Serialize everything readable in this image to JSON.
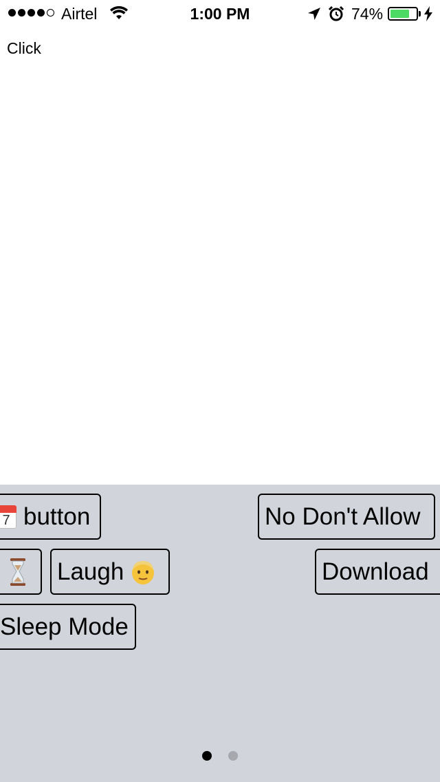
{
  "status_bar": {
    "carrier": "Airtel",
    "time": "1:00 PM",
    "battery_percent": "74%",
    "battery_level": 0.74,
    "battery_color": "#4cd964",
    "signal_bars_filled": 4,
    "signal_bars_total": 5
  },
  "content": {
    "label": "Click"
  },
  "keyboard": {
    "background": "#d1d5db",
    "keys": {
      "calendar_button": {
        "icon": "calendar-icon",
        "calendar_day": "7",
        "label": "button"
      },
      "no_dont_allow": {
        "label": "No Don't Allow"
      },
      "hourglass": {
        "icon": "hourglass-icon"
      },
      "laugh": {
        "label": "Laugh",
        "icon": "face-icon"
      },
      "download": {
        "label": "Download"
      },
      "sleep_mode": {
        "label": "Sleep Mode"
      }
    },
    "page_indicator": {
      "pages": 2,
      "current": 1
    }
  }
}
